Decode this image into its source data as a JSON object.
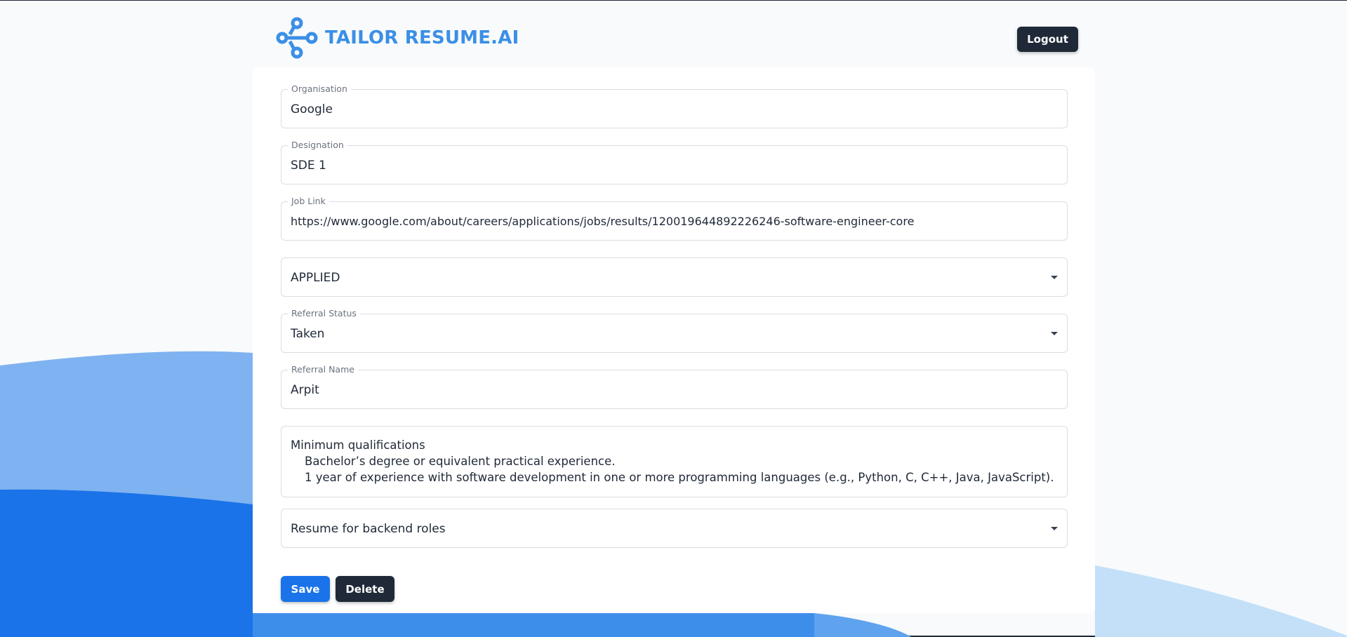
{
  "brand": {
    "name": "TAILOR RESUME.AI",
    "accent": "#3b8fe6"
  },
  "header": {
    "logout_label": "Logout"
  },
  "form": {
    "organisation": {
      "label": "Organisation",
      "value": "Google"
    },
    "designation": {
      "label": "Designation",
      "value": "SDE 1"
    },
    "job_link": {
      "label": "Job Link",
      "value": "https://www.google.com/about/careers/applications/jobs/results/120019644892226246-software-engineer-core"
    },
    "application_status": {
      "value": "APPLIED"
    },
    "referral_status": {
      "label": "Referral Status",
      "value": "Taken"
    },
    "referral_name": {
      "label": "Referral Name",
      "value": "Arpit"
    },
    "job_description": {
      "lines": [
        "Minimum qualifications",
        "Bachelor’s degree or equivalent practical experience.",
        "1 year of experience with software development in one or more programming languages (e.g., Python, C, C++, Java, JavaScript)."
      ]
    },
    "resume": {
      "value": "Resume for backend roles"
    }
  },
  "actions": {
    "save_label": "Save",
    "delete_label": "Delete"
  },
  "colors": {
    "primary": "#1a73e8",
    "dark": "#1f2937",
    "wave_light": "#7fb2f0",
    "wave_dark": "#1a73e8",
    "wave_pale": "#c3e0f8"
  }
}
